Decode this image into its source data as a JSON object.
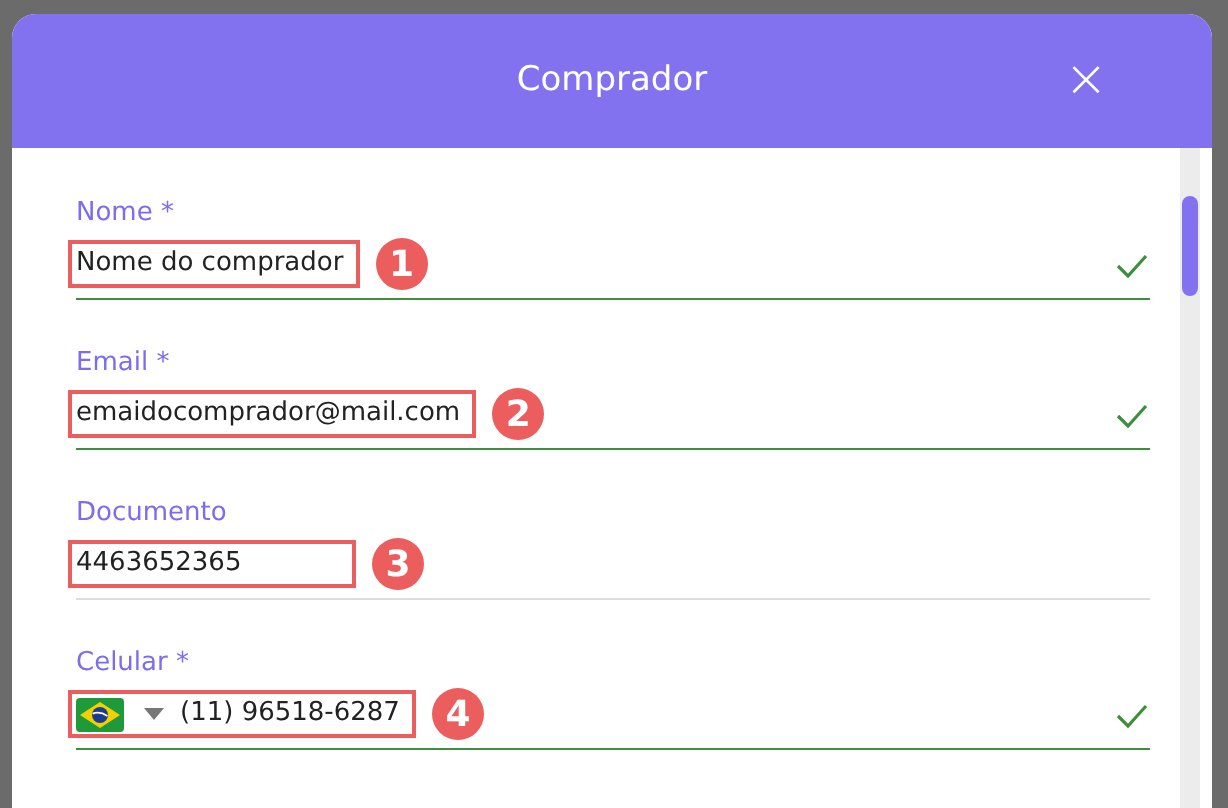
{
  "dialog": {
    "title": "Comprador",
    "close_label": "×"
  },
  "fields": [
    {
      "kind": "text",
      "label": "Nome *",
      "value": "Nome do comprador",
      "valid": true,
      "callout": "1"
    },
    {
      "kind": "text",
      "label": "Email *",
      "value": "emaidocomprador@mail.com",
      "valid": true,
      "callout": "2"
    },
    {
      "kind": "text",
      "label": "Documento",
      "value": "4463652365",
      "valid": false,
      "callout": "3"
    },
    {
      "kind": "phone",
      "label": "Celular *",
      "value": "(11) 96518-6287",
      "valid": true,
      "callout": "4"
    }
  ]
}
